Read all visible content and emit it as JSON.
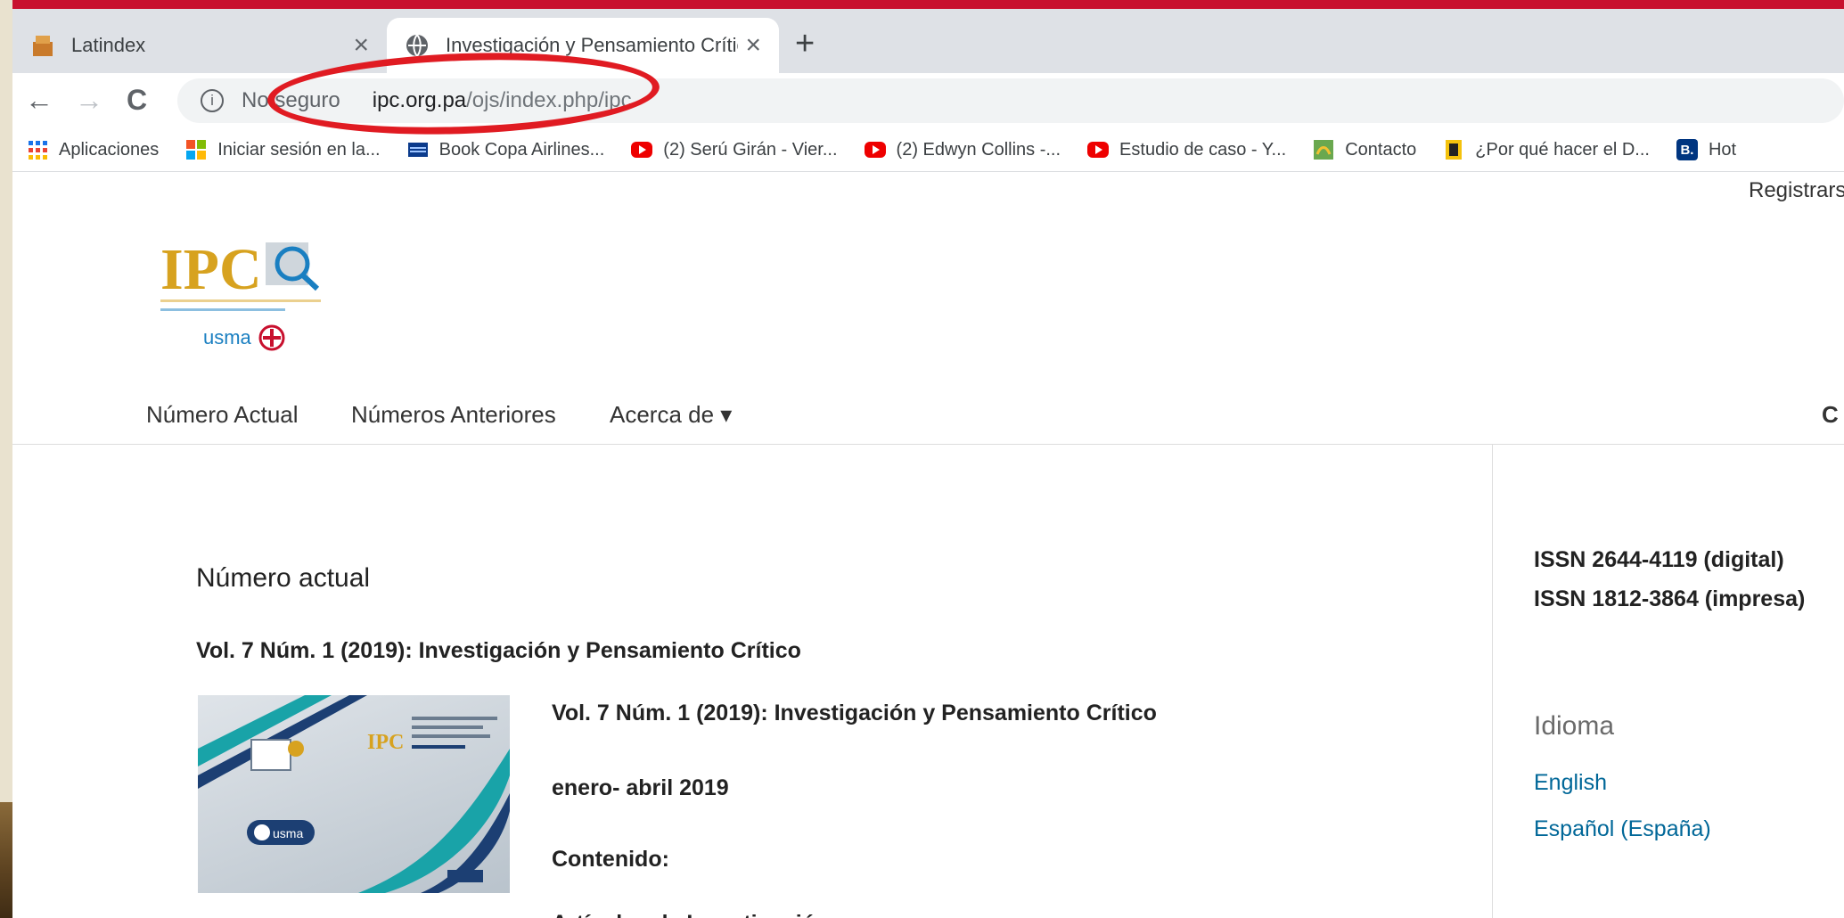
{
  "browser": {
    "tabs": [
      {
        "title": "Latindex",
        "close": "×"
      },
      {
        "title": "Investigación y Pensamiento Crítico",
        "close": "×"
      }
    ],
    "new_tab": "+",
    "nav": {
      "back": "←",
      "forward": "→",
      "reload": "C"
    },
    "address": {
      "info": "i",
      "security": "No seguro",
      "host": "ipc.org.pa",
      "path": "/ojs/index.php/ipc"
    },
    "bookmarks": [
      {
        "label": "Aplicaciones"
      },
      {
        "label": "Iniciar sesión en la..."
      },
      {
        "label": "Book Copa Airlines..."
      },
      {
        "label": "(2) Serú Girán - Vier..."
      },
      {
        "label": "(2) Edwyn Collins -..."
      },
      {
        "label": "Estudio de caso - Y..."
      },
      {
        "label": "Contacto"
      },
      {
        "label": "¿Por qué hacer el D..."
      },
      {
        "label": "Hot"
      }
    ],
    "bookmark_badge": "B."
  },
  "site": {
    "register": "Registrarse",
    "logo_text": "IPC",
    "logo_partner": "usma",
    "nav": [
      "Número Actual",
      "Números Anteriores",
      "Acerca de ▾",
      "C"
    ]
  },
  "main": {
    "heading": "Número actual",
    "volume_title": "Vol. 7 Núm. 1 (2019): Investigación y Pensamiento Crítico",
    "issue_lines": [
      "Vol. 7 Núm. 1 (2019): Investigación y Pensamiento Crítico",
      "enero- abril 2019",
      "Contenido:",
      "Artículos de Investigación"
    ]
  },
  "sidebar": {
    "issn": [
      "ISSN 2644-4119 (digital)",
      "ISSN 1812-3864 (impresa)"
    ],
    "language_heading": "Idioma",
    "languages": [
      "English",
      "Español (España)"
    ]
  },
  "colors": {
    "accent_red": "#c8102e",
    "link": "#006798",
    "logo_gold": "#d7a21f",
    "logo_blue": "#1a7fc1"
  }
}
